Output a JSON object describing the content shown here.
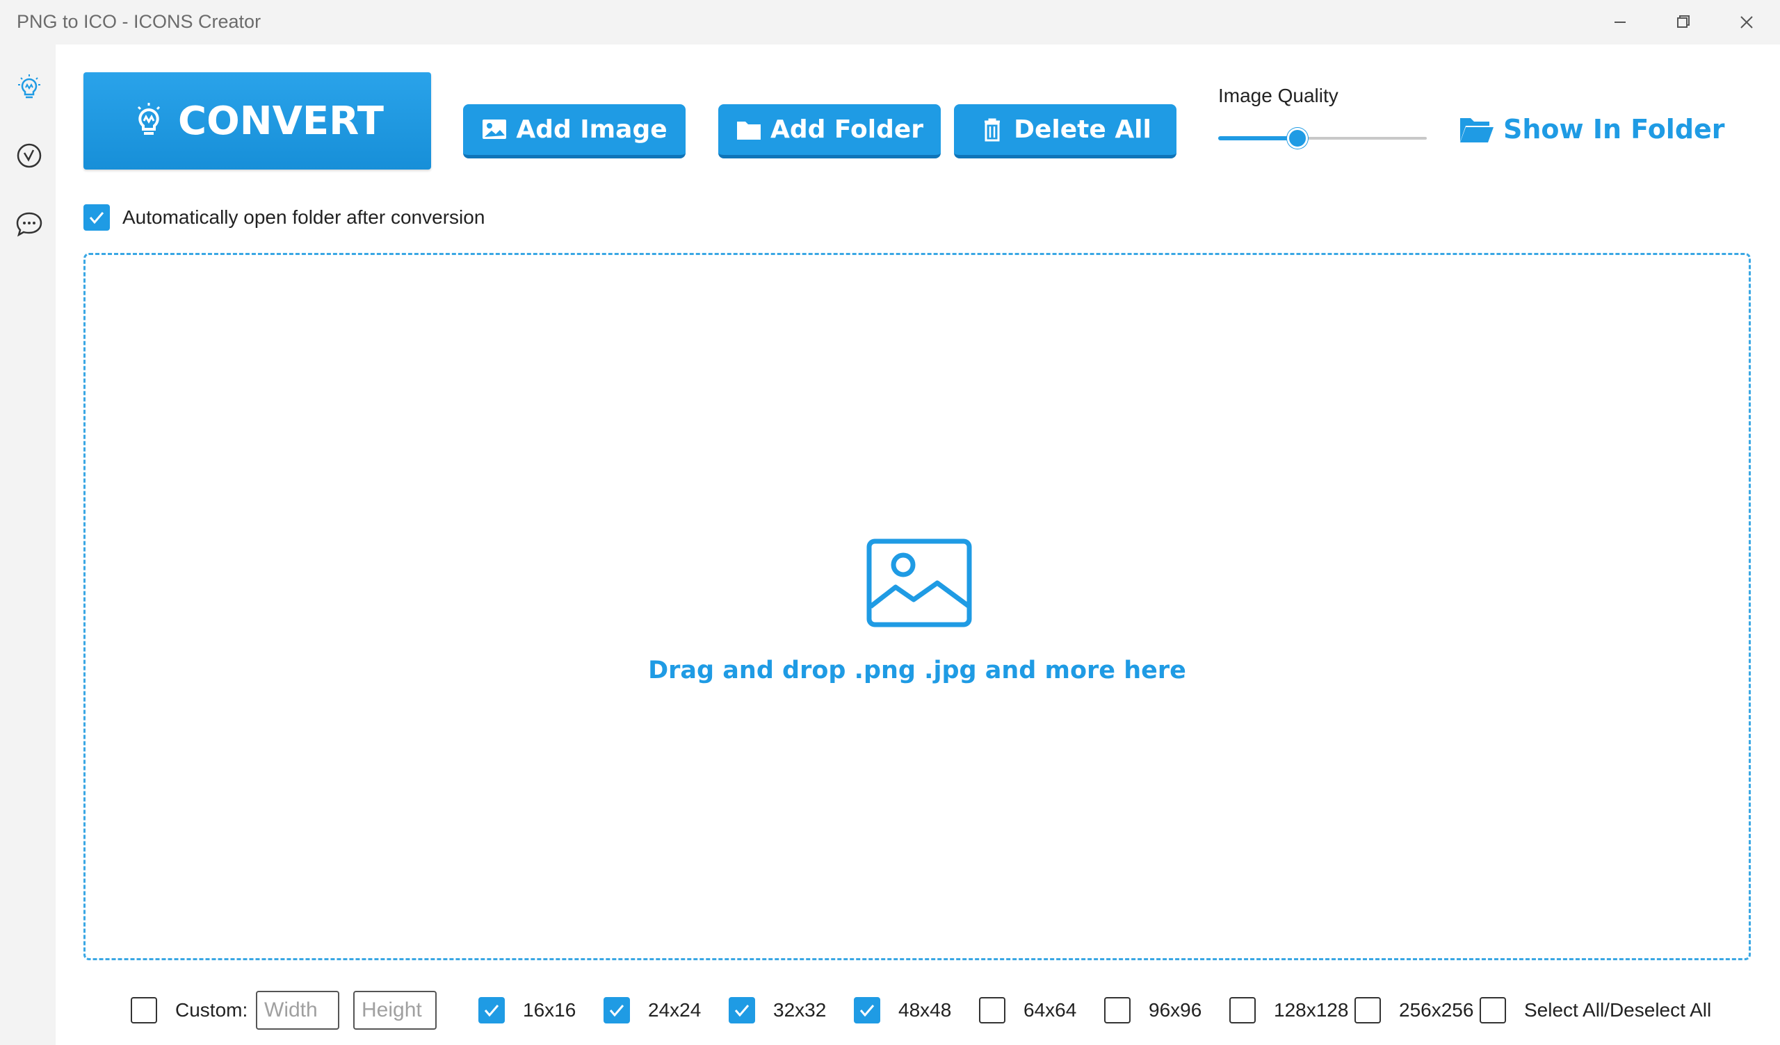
{
  "window": {
    "title": "PNG to ICO - ICONS Creator",
    "controls": [
      "minimize-icon",
      "restore-icon",
      "close-icon"
    ]
  },
  "sidebar": {
    "items": [
      {
        "name": "convert",
        "icon": "lightbulb-icon",
        "active": true
      },
      {
        "name": "check",
        "icon": "check-circle-icon",
        "active": false
      },
      {
        "name": "feedback",
        "icon": "chat-bubble-icon",
        "active": false
      }
    ]
  },
  "toolbar": {
    "convert_label": "CONVERT",
    "add_image_label": "Add Image",
    "add_folder_label": "Add Folder",
    "delete_all_label": "Delete All",
    "quality_label": "Image Quality",
    "quality_value": 0.38,
    "show_in_folder_label": "Show In Folder"
  },
  "options": {
    "auto_open_label": "Automatically open folder after conversion",
    "auto_open_checked": true
  },
  "dropzone": {
    "icon": "image-icon",
    "text": "Drag and drop .png .jpg and more here"
  },
  "sizes": {
    "custom_label": "Custom:",
    "custom_checked": false,
    "width_placeholder": "Width",
    "height_placeholder": "Height",
    "items": [
      {
        "label": "16x16",
        "checked": true
      },
      {
        "label": "24x24",
        "checked": true
      },
      {
        "label": "32x32",
        "checked": true
      },
      {
        "label": "48x48",
        "checked": true
      },
      {
        "label": "64x64",
        "checked": false
      },
      {
        "label": "96x96",
        "checked": false
      },
      {
        "label": "128x128",
        "checked": false
      },
      {
        "label": "256x256",
        "checked": false
      }
    ],
    "select_all_label": "Select All/Deselect All",
    "select_all_checked": false
  },
  "colors": {
    "accent": "#1f9be4",
    "sidebar_bg": "#f3f3f3"
  }
}
